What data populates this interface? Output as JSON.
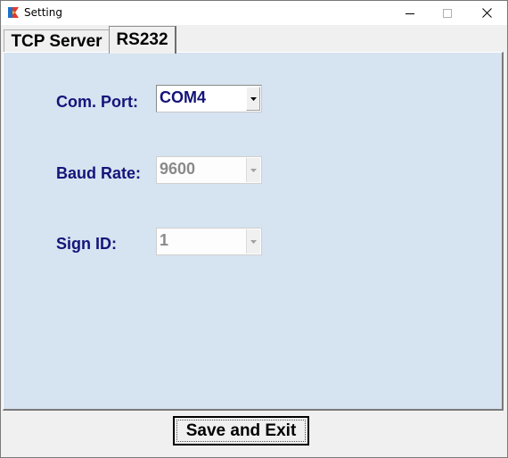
{
  "window": {
    "title": "Setting",
    "icon": "app-logo-icon"
  },
  "titlebar_buttons": {
    "minimize": "minimize-icon",
    "maximize": "maximize-icon",
    "close": "close-icon"
  },
  "tabs": [
    {
      "label": "TCP Server",
      "active": false
    },
    {
      "label": "RS232",
      "active": true
    }
  ],
  "form": {
    "com_port": {
      "label": "Com. Port:",
      "value": "COM4",
      "enabled": true
    },
    "baud_rate": {
      "label": "Baud Rate:",
      "value": "9600",
      "enabled": false
    },
    "sign_id": {
      "label": "Sign ID:",
      "value": "1",
      "enabled": false
    }
  },
  "footer": {
    "save_label": "Save and Exit"
  },
  "colors": {
    "panel_bg": "#d6e3f0",
    "label_text": "#14147a",
    "disabled_text": "#8a8a8a"
  }
}
